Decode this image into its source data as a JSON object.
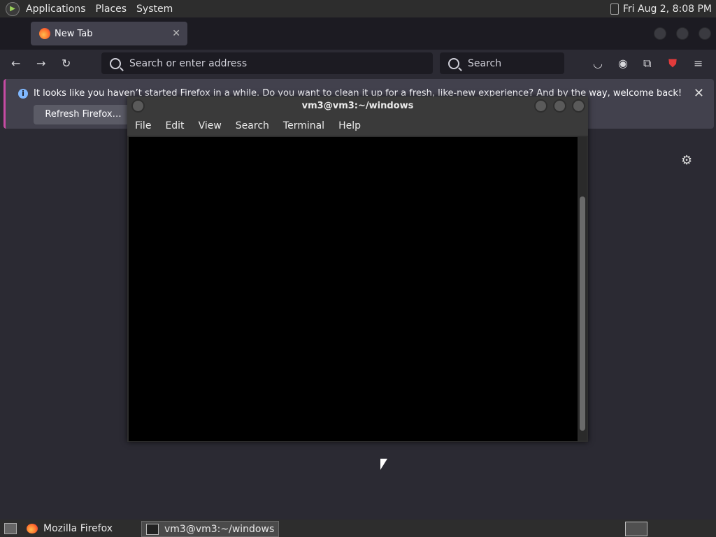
{
  "top_panel": {
    "menus": [
      "Applications",
      "Places",
      "System"
    ],
    "clock": "Fri Aug  2,  8:08 PM"
  },
  "firefox": {
    "tab_title": "New Tab",
    "url_placeholder": "Search or enter address",
    "search_placeholder": "Search",
    "notice": "It looks like you haven’t started Firefox in a while. Do you want to clean it up for a fresh, like-new experience? And by the way, welcome back!",
    "refresh_button": "Refresh Firefox…"
  },
  "terminal": {
    "title": "vm3@vm3:~/windows",
    "menu": [
      "File",
      "Edit",
      "View",
      "Search",
      "Terminal",
      "Help"
    ]
  },
  "taskbar": {
    "items": [
      "Mozilla Firefox",
      "vm3@vm3:~/windows"
    ]
  },
  "colors": {
    "error_red": "#ef2929",
    "arrow_green": "#8ae234",
    "notice_accent": "#c64ba3"
  }
}
